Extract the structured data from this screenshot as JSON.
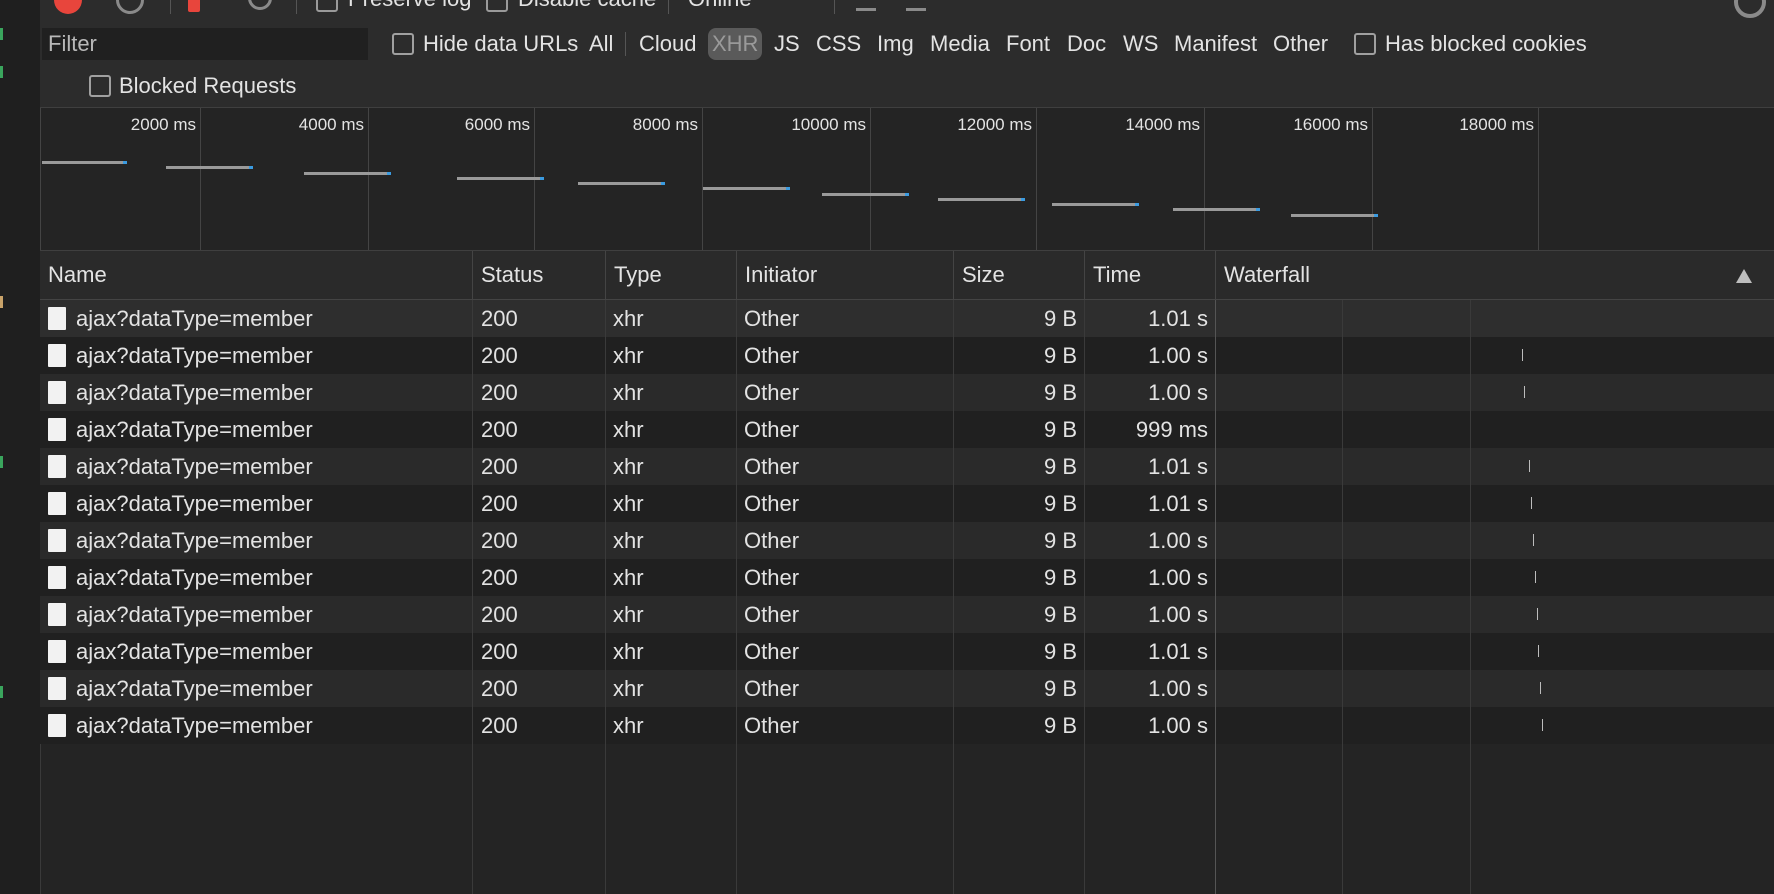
{
  "toolbar": {
    "preserve_log_label": "Preserve log",
    "disable_cache_label": "Disable cache",
    "throttle_value": "Online"
  },
  "filterbar": {
    "filter_placeholder": "Filter",
    "hide_data_urls_label": "Hide data URLs",
    "types": [
      "All",
      "Cloud",
      "XHR",
      "JS",
      "CSS",
      "Img",
      "Media",
      "Font",
      "Doc",
      "WS",
      "Manifest",
      "Other"
    ],
    "active_type": "XHR",
    "has_blocked_cookies_label": "Has blocked cookies",
    "blocked_requests_label": "Blocked Requests"
  },
  "overview": {
    "tick_labels": [
      "2000 ms",
      "4000 ms",
      "6000 ms",
      "8000 ms",
      "10000 ms",
      "12000 ms",
      "14000 ms",
      "16000 ms",
      "18000 ms"
    ]
  },
  "table": {
    "columns": [
      "Name",
      "Status",
      "Type",
      "Initiator",
      "Size",
      "Time",
      "Waterfall"
    ],
    "sort_column": "Waterfall",
    "sort_direction": "ascending",
    "rows": [
      {
        "name": "ajax?dataType=member",
        "status": "200",
        "type": "xhr",
        "initiator": "Other",
        "size": "9 B",
        "time": "1.01 s"
      },
      {
        "name": "ajax?dataType=member",
        "status": "200",
        "type": "xhr",
        "initiator": "Other",
        "size": "9 B",
        "time": "1.00 s"
      },
      {
        "name": "ajax?dataType=member",
        "status": "200",
        "type": "xhr",
        "initiator": "Other",
        "size": "9 B",
        "time": "1.00 s"
      },
      {
        "name": "ajax?dataType=member",
        "status": "200",
        "type": "xhr",
        "initiator": "Other",
        "size": "9 B",
        "time": "999 ms"
      },
      {
        "name": "ajax?dataType=member",
        "status": "200",
        "type": "xhr",
        "initiator": "Other",
        "size": "9 B",
        "time": "1.01 s"
      },
      {
        "name": "ajax?dataType=member",
        "status": "200",
        "type": "xhr",
        "initiator": "Other",
        "size": "9 B",
        "time": "1.01 s"
      },
      {
        "name": "ajax?dataType=member",
        "status": "200",
        "type": "xhr",
        "initiator": "Other",
        "size": "9 B",
        "time": "1.00 s"
      },
      {
        "name": "ajax?dataType=member",
        "status": "200",
        "type": "xhr",
        "initiator": "Other",
        "size": "9 B",
        "time": "1.00 s"
      },
      {
        "name": "ajax?dataType=member",
        "status": "200",
        "type": "xhr",
        "initiator": "Other",
        "size": "9 B",
        "time": "1.00 s"
      },
      {
        "name": "ajax?dataType=member",
        "status": "200",
        "type": "xhr",
        "initiator": "Other",
        "size": "9 B",
        "time": "1.01 s"
      },
      {
        "name": "ajax?dataType=member",
        "status": "200",
        "type": "xhr",
        "initiator": "Other",
        "size": "9 B",
        "time": "1.00 s"
      },
      {
        "name": "ajax?dataType=member",
        "status": "200",
        "type": "xhr",
        "initiator": "Other",
        "size": "9 B",
        "time": "1.00 s"
      }
    ]
  },
  "colors": {
    "background": "#242424",
    "record": "#e8453c",
    "bar_start": "#9a9a9a",
    "bar_end": "#3b9be0"
  },
  "icons": [
    "record-icon",
    "clear-icon",
    "filter-icon",
    "search-icon",
    "import-icon",
    "export-icon",
    "settings-icon",
    "document-icon",
    "sort-ascending-icon"
  ]
}
